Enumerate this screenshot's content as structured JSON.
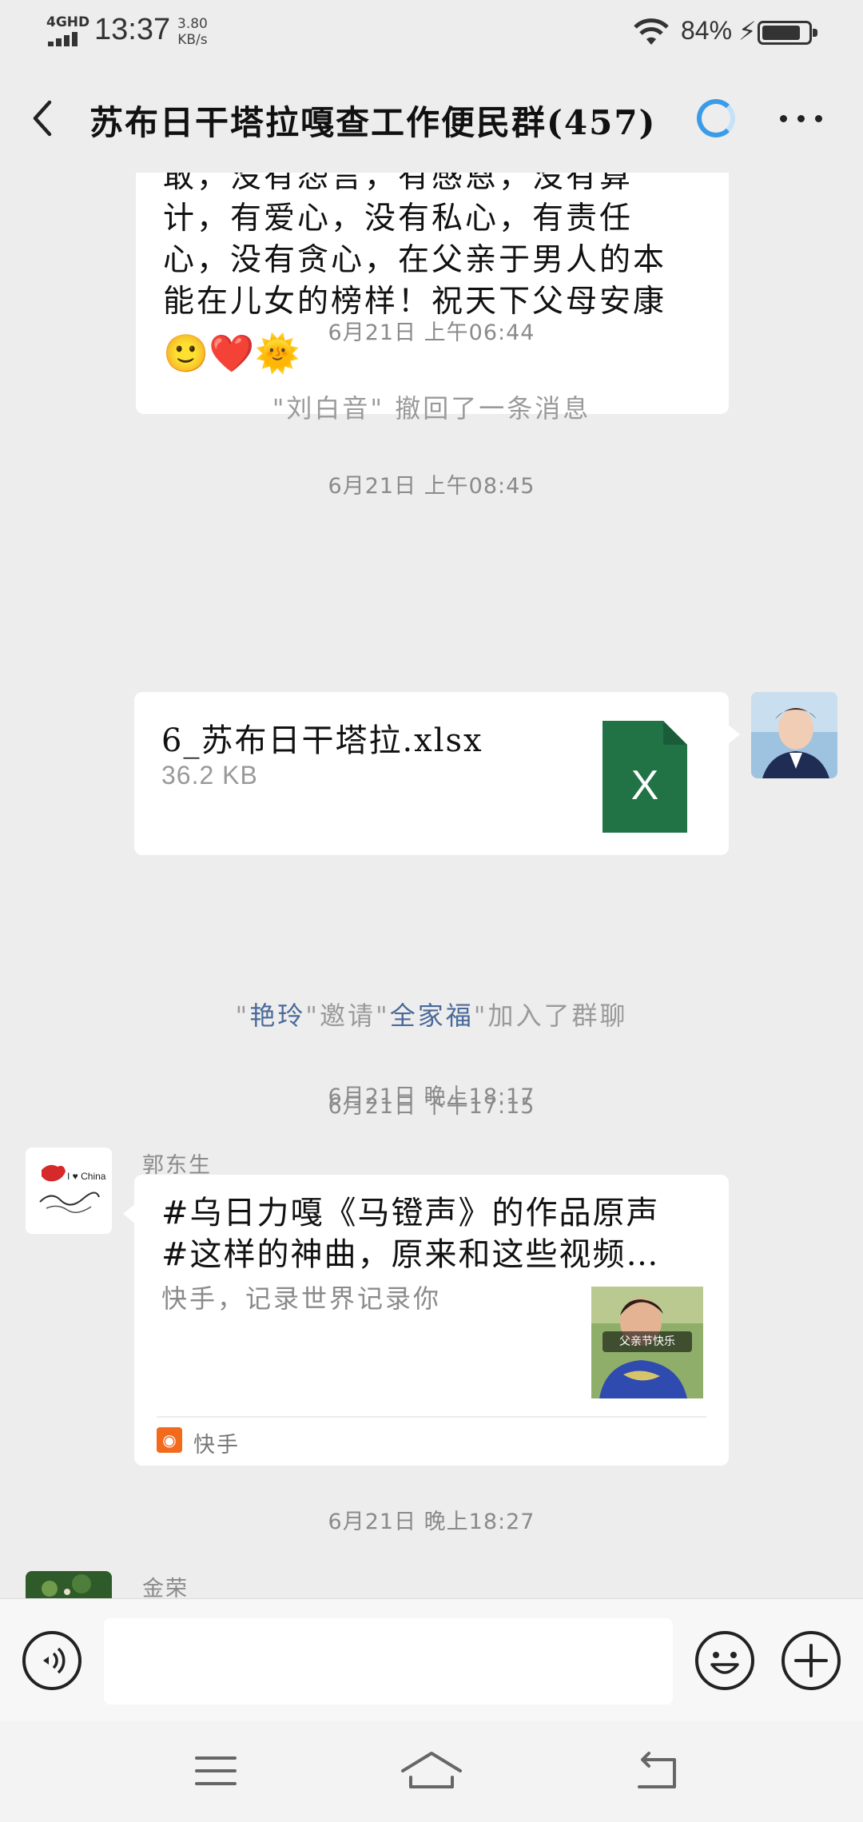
{
  "status_bar": {
    "network": "4GHD",
    "time": "13:37",
    "speed_value": "3.80",
    "speed_unit": "KB/s",
    "battery_percent": "84%",
    "battery_level": 0.84
  },
  "header": {
    "title": "苏布日干塔拉嘎查工作便民群(457)"
  },
  "messages": {
    "partial_text": {
      "lines": [
        "敢，没有怨言，有感恩，没有算",
        "计，有爱心，没有私心，有责任",
        "心，没有贪心，在父亲于男人的本",
        "能在儿女的榜样！祝天下父母安康"
      ],
      "emojis": "🙂❤️🌞"
    },
    "ts1": "6月21日 上午06:44",
    "recall_notice": "\"刘白音\" 撤回了一条消息",
    "ts2": "6月21日 上午08:45",
    "file": {
      "name": "6_苏布日干塔拉.xlsx",
      "size": "36.2 KB",
      "icon_letter": "X"
    },
    "ts3": "6月21日 下午17:15",
    "invite": {
      "q1": "\"",
      "inviter": "艳玲",
      "mid": "\"邀请\"",
      "invitee": "全家福",
      "tail": "\"加入了群聊"
    },
    "ts4": "6月21日 晚上18:17",
    "link": {
      "sender": "郭东生",
      "title_line1": "#乌日力嘎《马镫声》的作品原声",
      "title_line2": "#这样的神曲，原来和这些视频…",
      "desc": "快手，记录世界记录你",
      "thumb_caption": "父亲节快乐",
      "app_name": "快手",
      "app_icon": "kuaishou-icon"
    },
    "ts5": "6月21日 晚上18:27",
    "next_sender": "金荣"
  },
  "input": {
    "placeholder": ""
  },
  "colors": {
    "excel_green": "#217346",
    "link_blue": "#4a6a9a",
    "kuaishou_orange": "#f26b1d",
    "spinner_blue": "#3a9be8"
  }
}
